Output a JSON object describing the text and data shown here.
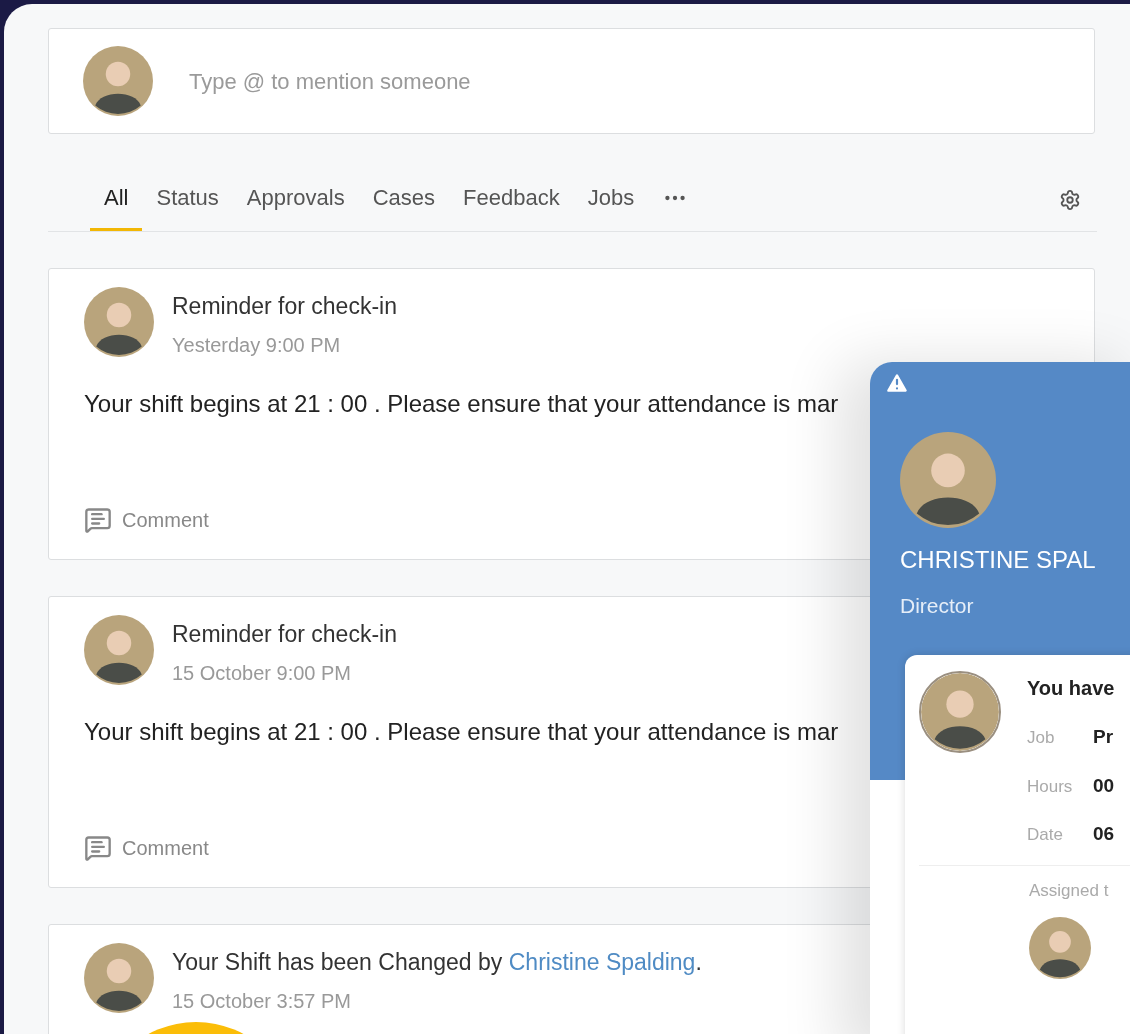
{
  "composer": {
    "placeholder": "Type @ to mention someone"
  },
  "tabs": [
    {
      "label": "All",
      "selected": true
    },
    {
      "label": "Status",
      "selected": false
    },
    {
      "label": "Approvals",
      "selected": false
    },
    {
      "label": "Cases",
      "selected": false
    },
    {
      "label": "Feedback",
      "selected": false
    },
    {
      "label": "Jobs",
      "selected": false
    }
  ],
  "posts": [
    {
      "title": "Reminder for check-in",
      "time": "Yesterday 9:00 PM",
      "body": "Your shift begins at 21 : 00 . Please ensure that your attendance is mar",
      "comment": "Comment"
    },
    {
      "title": "Reminder for check-in",
      "time": "15 October 9:00 PM",
      "body": "Your shift begins at 21 : 00 . Please ensure that your attendance is mar",
      "comment": "Comment"
    },
    {
      "title": "Your Shift has been Changed by",
      "link": "Christine Spalding",
      "title_end": ".",
      "time": "15 October 3:57 PM"
    }
  ],
  "profile_card": {
    "name": "CHRISTINE SPAL",
    "role": "Director",
    "heading": "You have",
    "rows": [
      {
        "label": "Job",
        "value": "Pr"
      },
      {
        "label": "Hours",
        "value": "00"
      },
      {
        "label": "Date",
        "value": "06"
      }
    ],
    "assigned_label": "Assigned t"
  }
}
